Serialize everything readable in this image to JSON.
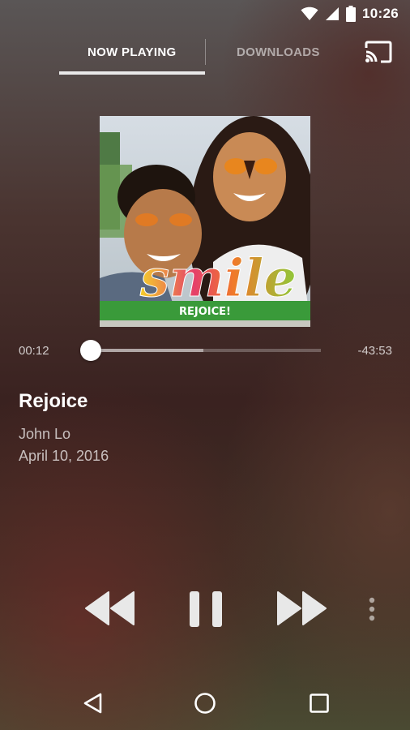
{
  "status_bar": {
    "time": "10:26"
  },
  "tabs": [
    {
      "label": "NOW PLAYING",
      "active": true
    },
    {
      "label": "DOWNLOADS",
      "active": false
    }
  ],
  "header": {
    "cast_icon": "cast-icon"
  },
  "album_art": {
    "overlay_text": "smile",
    "banner_text": "REJOICE!"
  },
  "player": {
    "elapsed": "00:12",
    "remaining": "-43:53",
    "buffered_fraction": 0.49,
    "progress_fraction": 0.005
  },
  "track": {
    "title": "Rejoice",
    "artist": "John Lo",
    "date": "April 10, 2016"
  },
  "controls": {
    "rewind_icon": "rewind-icon",
    "pause_icon": "pause-icon",
    "fast_forward_icon": "fast-forward-icon",
    "more_icon": "more-vert-icon"
  },
  "colors": {
    "accent": "#ffffff",
    "banner_green": "#3a9a3a"
  }
}
